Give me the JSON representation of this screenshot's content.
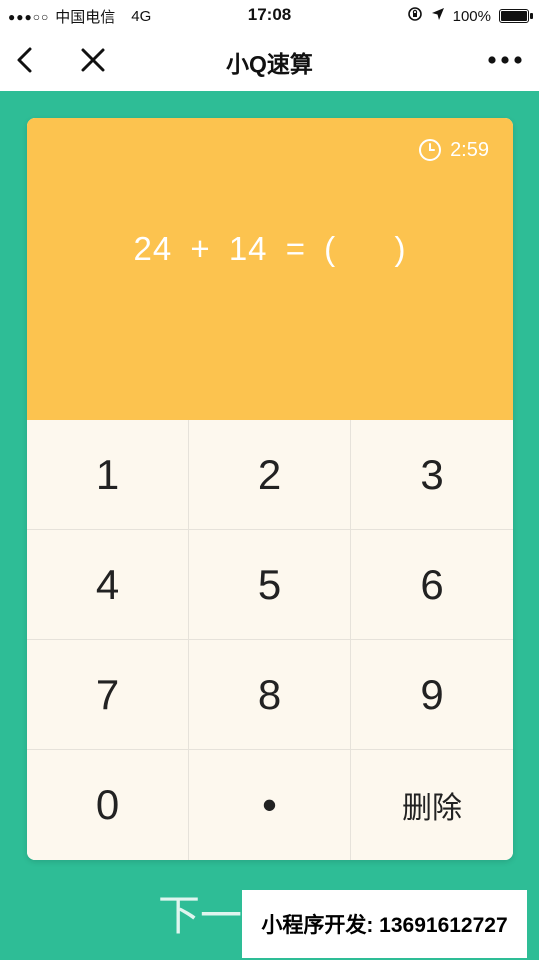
{
  "status_bar": {
    "signal_dots": "●●●○○",
    "carrier": "中国电信",
    "network": "4G",
    "time": "17:08",
    "battery_percent": "100%",
    "battery_level": 1.0
  },
  "nav": {
    "title": "小Q速算",
    "back_icon": "chevron-left-icon",
    "close_icon": "close-icon",
    "more_icon": "more-dots-icon"
  },
  "quiz": {
    "timer": "2:59",
    "operand_a": "24",
    "operator": "+",
    "operand_b": "14",
    "equals": "=",
    "answer_open": "(",
    "answer_close": ")"
  },
  "keypad": {
    "keys": [
      "1",
      "2",
      "3",
      "4",
      "5",
      "6",
      "7",
      "8",
      "9",
      "0",
      "•",
      "删除"
    ]
  },
  "next_button": "下一",
  "watermark": "小程序开发: 13691612727",
  "colors": {
    "background": "#2ebd96",
    "card_top": "#fcc34f",
    "keypad": "#fdf8ee"
  }
}
